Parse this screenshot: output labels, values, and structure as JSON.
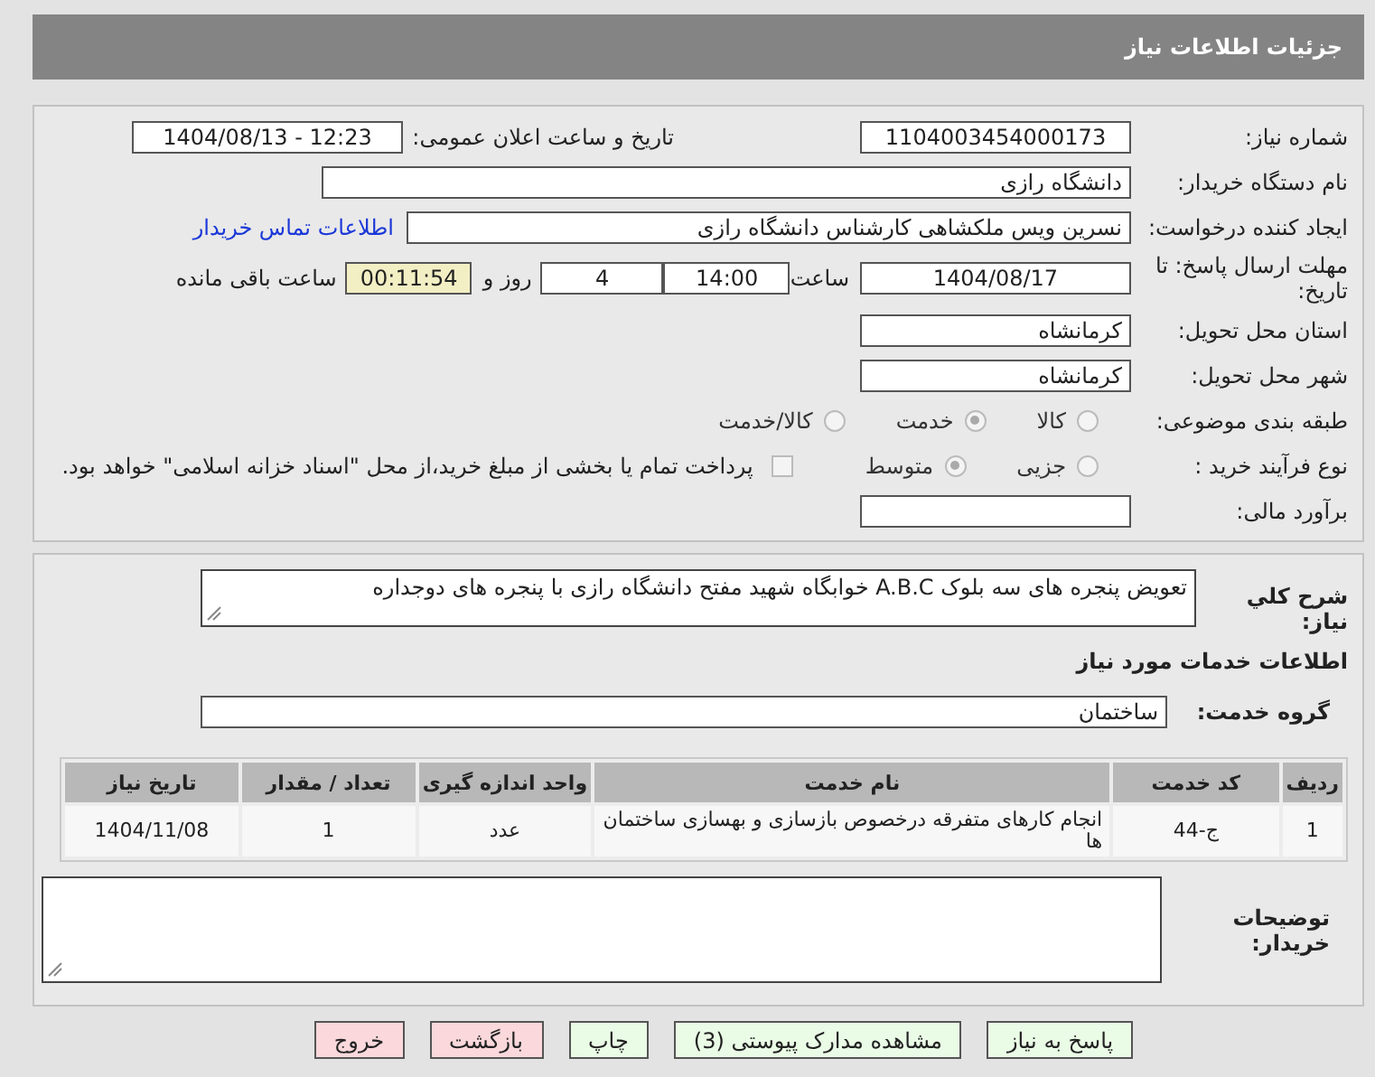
{
  "header": {
    "title": "جزئیات اطلاعات نیاز"
  },
  "details": {
    "need_number": {
      "label": "شماره نیاز:",
      "value": "1104003454000173"
    },
    "announce": {
      "label": "تاریخ و ساعت اعلان عمومی:",
      "value": "1404/08/13 - 12:23"
    },
    "buyer": {
      "label": "نام دستگاه خریدار:",
      "value": "دانشگاه رازی"
    },
    "creator": {
      "label": "ایجاد کننده درخواست:",
      "value": "نسرین ویس ملکشاهی کارشناس دانشگاه رازی",
      "link": "اطلاعات تماس خریدار"
    },
    "deadline": {
      "label": "مهلت ارسال پاسخ: تا تاریخ:",
      "date": "1404/08/17",
      "time_label": "ساعت",
      "time": "14:00",
      "days": "4",
      "days_label": "روز و",
      "remaining": "00:11:54",
      "remaining_label": "ساعت باقی مانده"
    },
    "province": {
      "label": "استان محل تحویل:",
      "value": "کرمانشاه"
    },
    "city": {
      "label": "شهر محل تحویل:",
      "value": "کرمانشاه"
    },
    "category": {
      "label": "طبقه بندی موضوعی:",
      "options": [
        {
          "label": "کالا",
          "selected": false
        },
        {
          "label": "خدمت",
          "selected": true
        },
        {
          "label": "کالا/خدمت",
          "selected": false
        }
      ]
    },
    "process": {
      "label": "نوع فرآیند خرید :",
      "options": [
        {
          "label": "جزیی",
          "selected": false
        },
        {
          "label": "متوسط",
          "selected": true
        }
      ],
      "payment": {
        "checked": false,
        "text": "پرداخت تمام یا بخشی از مبلغ خرید،از محل \"اسناد خزانه اسلامی\" خواهد بود."
      }
    },
    "estimate": {
      "label": "برآورد مالی:"
    }
  },
  "need": {
    "summary_label": "شرح کلي نیاز:",
    "summary": "تعویض پنجره های سه بلوک A.B.C خوابگاه شهید مفتح دانشگاه رازی با پنجره های دوجداره",
    "services_heading": "اطلاعات خدمات مورد نیاز",
    "group_label": "گروه خدمت:",
    "group": "ساختمان",
    "table": {
      "columns": [
        "ردیف",
        "کد خدمت",
        "نام خدمت",
        "واحد اندازه گیری",
        "تعداد / مقدار",
        "تاریخ نیاز"
      ],
      "rows": [
        {
          "cells": [
            "1",
            "ج-44",
            "انجام کارهای متفرقه درخصوص بازسازی و بهسازی ساختمان ها",
            "عدد",
            "1",
            "1404/11/08"
          ]
        }
      ]
    },
    "notes_label": "توضیحات خریدار:"
  },
  "buttons": [
    {
      "label": "پاسخ به نیاز",
      "kind": "primary"
    },
    {
      "label": "مشاهده مدارک پیوستی (3)",
      "kind": "primary"
    },
    {
      "label": "چاپ",
      "kind": "primary"
    },
    {
      "label": "بازگشت",
      "kind": "danger"
    },
    {
      "label": "خروج",
      "kind": "danger"
    }
  ]
}
